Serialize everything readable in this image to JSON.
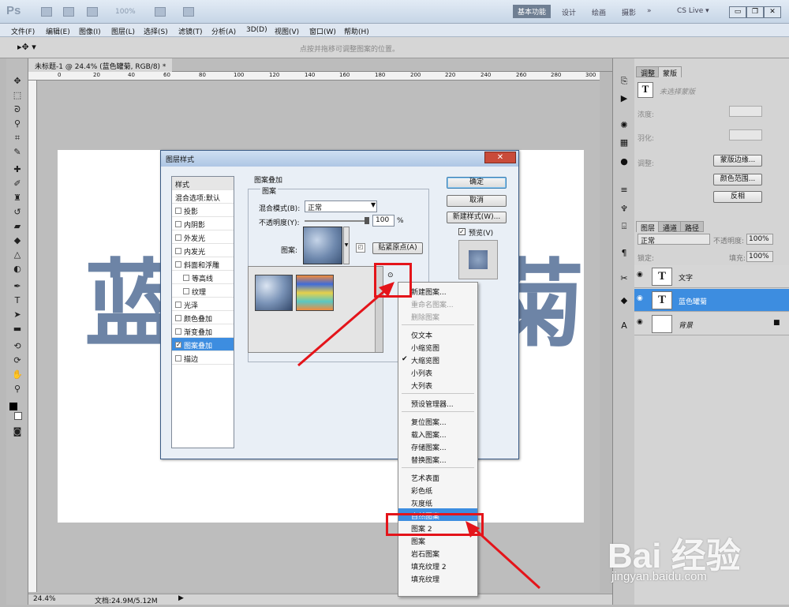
{
  "app": {
    "logo": "Ps",
    "zoom": "100%",
    "workspace_active": "基本功能",
    "workspaces": [
      "设计",
      "绘画",
      "摄影",
      "»"
    ],
    "cslive": "CS Live ▾"
  },
  "menu": [
    "文件(F)",
    "编辑(E)",
    "图像(I)",
    "图层(L)",
    "选择(S)",
    "滤镜(T)",
    "分析(A)",
    "3D(D)",
    "视图(V)",
    "窗口(W)",
    "帮助(H)"
  ],
  "options": {
    "hint": "点按并拖移可调整图案的位置。"
  },
  "document": {
    "tab": "未标题-1 @ 24.4% (蓝色罐菊, RGB/8) *",
    "chars": [
      "蓝",
      "菊"
    ],
    "ruler_ticks": [
      "0",
      "20",
      "40",
      "60",
      "80",
      "100",
      "120",
      "140",
      "160",
      "180",
      "200",
      "220",
      "240",
      "260",
      "280",
      "300"
    ]
  },
  "status": {
    "zoom": "24.4%",
    "doc": "文档:24.9M/5.12M"
  },
  "dialog": {
    "title": "图层样式",
    "close": "✕",
    "styles_header": "样式",
    "styles": [
      {
        "label": "混合选项:默认",
        "checked": false,
        "indent": 0,
        "nocb": true
      },
      {
        "label": "投影",
        "checked": false,
        "indent": 0
      },
      {
        "label": "内阴影",
        "checked": false,
        "indent": 0
      },
      {
        "label": "外发光",
        "checked": false,
        "indent": 0
      },
      {
        "label": "内发光",
        "checked": false,
        "indent": 0
      },
      {
        "label": "斜面和浮雕",
        "checked": false,
        "indent": 0
      },
      {
        "label": "等高线",
        "checked": false,
        "indent": 1
      },
      {
        "label": "纹理",
        "checked": false,
        "indent": 1
      },
      {
        "label": "光泽",
        "checked": false,
        "indent": 0
      },
      {
        "label": "颜色叠加",
        "checked": false,
        "indent": 0
      },
      {
        "label": "渐变叠加",
        "checked": false,
        "indent": 0
      },
      {
        "label": "图案叠加",
        "checked": true,
        "indent": 0,
        "selected": true
      },
      {
        "label": "描边",
        "checked": false,
        "indent": 0
      }
    ],
    "section_title": "图案叠加",
    "group_title": "图案",
    "blend_label": "混合模式(B):",
    "blend_value": "正常",
    "opacity_label": "不透明度(Y):",
    "opacity_value": "100",
    "opacity_unit": "%",
    "opacity_level": 1.0,
    "pattern_label": "图案:",
    "snap_button": "贴紧原点(A)",
    "ok": "确定",
    "cancel": "取消",
    "new_style": "新建样式(W)...",
    "preview": "预览(V)"
  },
  "pattern_menu": {
    "items": [
      {
        "label": "新建图案...",
        "disabled": false
      },
      {
        "label": "重命名图案...",
        "disabled": true
      },
      {
        "label": "删除图案",
        "disabled": true
      },
      {
        "sep": true
      },
      {
        "label": "仅文本"
      },
      {
        "label": "小缩览图"
      },
      {
        "label": "大缩览图",
        "checked": true
      },
      {
        "label": "小列表"
      },
      {
        "label": "大列表"
      },
      {
        "sep": true
      },
      {
        "label": "预设管理器..."
      },
      {
        "sep": true
      },
      {
        "label": "复位图案..."
      },
      {
        "label": "载入图案..."
      },
      {
        "label": "存储图案..."
      },
      {
        "label": "替换图案..."
      },
      {
        "sep": true
      },
      {
        "label": "艺术表面"
      },
      {
        "label": "彩色纸"
      },
      {
        "label": "灰度纸"
      },
      {
        "label": "自然图案",
        "highlight": true
      },
      {
        "label": "图案 2"
      },
      {
        "label": "图案"
      },
      {
        "label": "岩石图案"
      },
      {
        "label": "填充纹理 2"
      },
      {
        "label": "填充纹理"
      }
    ],
    "check": "✔"
  },
  "panels": {
    "top_tabs": [
      "调整",
      "蒙版"
    ],
    "mask_title": "未选择蒙版",
    "density": "浓度:",
    "feather": "羽化:",
    "refine": "调整:",
    "mask_edge": "蒙版边缘...",
    "color_range": "颜色范围...",
    "invert": "反相",
    "layer_tabs": [
      "图层",
      "通道",
      "路径"
    ],
    "blend": "正常",
    "opacity_label": "不透明度:",
    "opacity": "100%",
    "lock": "锁定:",
    "fill_label": "填充:",
    "fill": "100%",
    "layers": [
      {
        "name": "文字",
        "thumb": "T",
        "selected": false
      },
      {
        "name": "蓝色罐菊",
        "thumb": "T",
        "selected": true
      },
      {
        "name": "背景",
        "thumb": "",
        "selected": false,
        "lock": "🔒"
      }
    ]
  },
  "watermark": {
    "main": "Bai 经验",
    "sub": "jingyan.baidu.com"
  },
  "colors": {
    "accent": "#3d8de0",
    "annotation": "#e4141a",
    "text_pattern": "#6d84a6"
  }
}
